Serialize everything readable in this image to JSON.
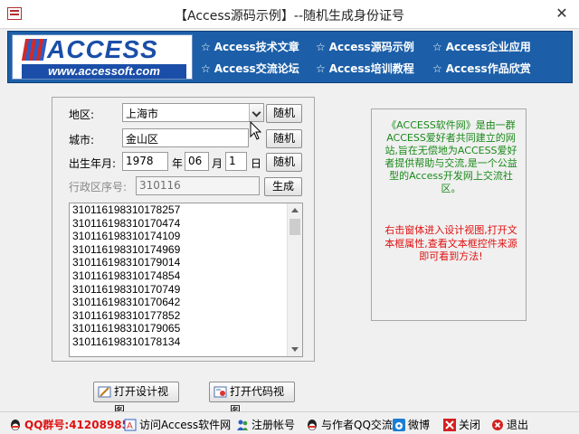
{
  "window": {
    "title": "【Access源码示例】--随机生成身份证号",
    "close_glyph": "✕"
  },
  "banner": {
    "logo_text": "ACCESS",
    "logo_url": "www.accessoft.com",
    "menu": [
      {
        "star": "☆",
        "label": "Access技术文章"
      },
      {
        "star": "☆",
        "label": "Access源码示例"
      },
      {
        "star": "☆",
        "label": "Access企业应用"
      },
      {
        "star": "☆",
        "label": "Access交流论坛"
      },
      {
        "star": "☆",
        "label": "Access培训教程"
      },
      {
        "star": "☆",
        "label": "Access作品欣赏"
      }
    ]
  },
  "form": {
    "region_label": "地区:",
    "region_value": "上海市",
    "region_button": "随机",
    "city_label": "城市:",
    "city_value": "金山区",
    "city_button": "随机",
    "birth_label": "出生年月:",
    "year_value": "1978",
    "year_unit": "年",
    "month_value": "06",
    "month_unit": "月",
    "day_value": "1",
    "day_unit": "日",
    "birth_button": "随机",
    "seq_label": "行政区序号:",
    "seq_value": "310116",
    "generate_button": "生成"
  },
  "id_list": [
    "310116198310178257",
    "310116198310170474",
    "310116198310174109",
    "310116198310174969",
    "310116198310179014",
    "310116198310174854",
    "310116198310170749",
    "310116198310170642",
    "310116198310177852",
    "310116198310179065",
    "310116198310178134"
  ],
  "info": {
    "green_text": "《ACCESS软件网》是由一群ACCESS爱好者共同建立的网站,旨在无偿地为ACCESS爱好者提供帮助与交流,是一个公益型的Access开发网上交流社区。",
    "red_text": "右击窗体进入设计视图,打开文本框属性,查看文本框控件来源即可看到方法!"
  },
  "actions": {
    "design_view": "打开设计视图",
    "code_view": "打开代码视图"
  },
  "statusbar": {
    "qq_group": "QQ群号:41208985",
    "visit_site": "访问Access软件网",
    "register": "注册帐号",
    "qq_chat": "与作者QQ交流",
    "weibo": "微博",
    "close": "关闭",
    "exit": "退出"
  },
  "colors": {
    "banner_bg": "#1c5fa8",
    "info_green": "#1a8a1a",
    "info_red": "#e01010"
  }
}
